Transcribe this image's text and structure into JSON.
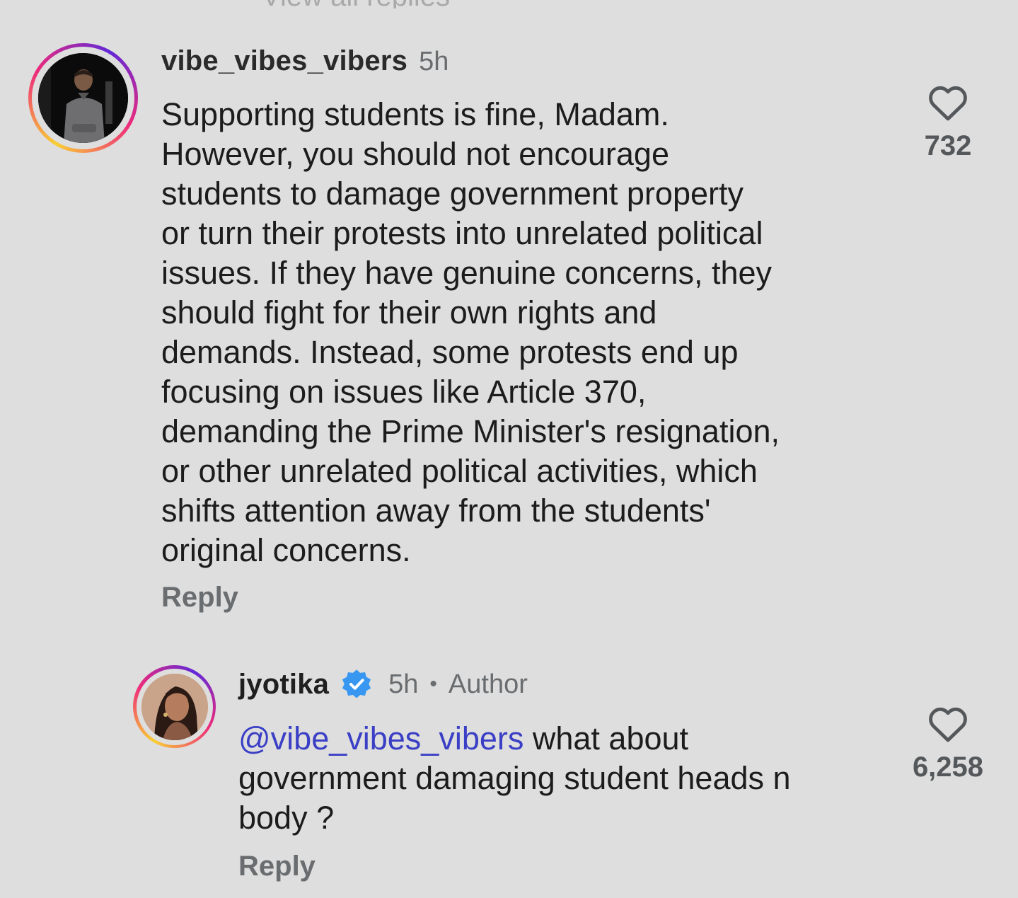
{
  "top_cutoff_text": "View all replies",
  "comments": [
    {
      "username": "vibe_vibes_vibers",
      "time": "5h",
      "body": "Supporting students is fine, Madam.\nHowever, you should not encourage\nstudents to damage government property\nor turn their protests into unrelated political\nissues. If they have genuine concerns, they\nshould fight for their own rights and\ndemands. Instead, some protests end up\nfocusing on issues like Article 370,\ndemanding the Prime Minister's resignation,\nor other unrelated political activities, which\nshifts attention away from the students'\noriginal concerns.",
      "reply_label": "Reply",
      "likes": "732",
      "avatar_icon": "user-avatar",
      "heart_icon": "heart-outline-icon"
    },
    {
      "username": "jyotika",
      "verified": true,
      "time": "5h",
      "separator": "•",
      "author_label": "Author",
      "mention": "@vibe_vibes_vibers",
      "body_rest": " what about\ngovernment damaging student heads n\nbody ?",
      "reply_label": "Reply",
      "likes": "6,258",
      "avatar_icon": "user-avatar",
      "heart_icon": "heart-outline-icon",
      "verified_icon": "verified-badge-icon"
    }
  ],
  "colors": {
    "background": "#dedede",
    "text": "#1c1c1c",
    "muted": "#6a6d70",
    "mention": "#3a3fc5",
    "verified": "#3897f0"
  }
}
